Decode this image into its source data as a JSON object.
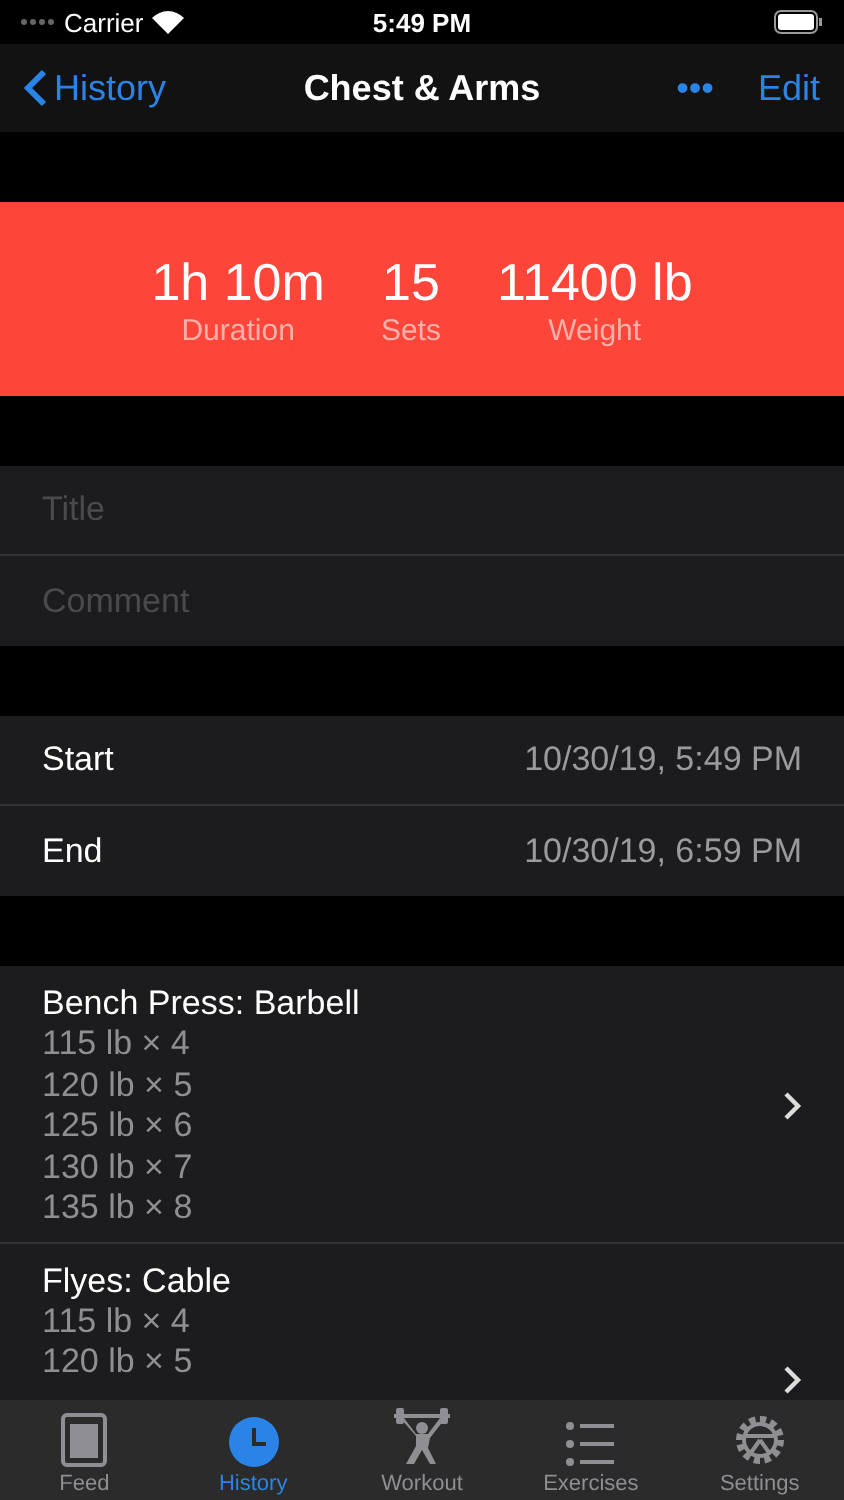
{
  "status_bar": {
    "carrier": "Carrier",
    "time": "5:49 PM"
  },
  "nav": {
    "back": "History",
    "title": "Chest & Arms",
    "more": "•••",
    "edit": "Edit"
  },
  "summary": [
    {
      "value": "1h 10m",
      "label": "Duration"
    },
    {
      "value": "15",
      "label": "Sets"
    },
    {
      "value": "11400 lb",
      "label": "Weight"
    }
  ],
  "fields": [
    {
      "placeholder": "Title"
    },
    {
      "placeholder": "Comment"
    }
  ],
  "times": [
    {
      "label": "Start",
      "value": "10/30/19, 5:49 PM"
    },
    {
      "label": "End",
      "value": "10/30/19, 6:59 PM"
    }
  ],
  "exercises": [
    {
      "name": "Bench Press: Barbell",
      "sets": [
        "115 lb × 4",
        "120 lb × 5",
        "125 lb × 6",
        "130 lb × 7",
        "135 lb × 8"
      ]
    },
    {
      "name": "Flyes: Cable",
      "sets": [
        "115 lb × 4",
        "120 lb × 5"
      ]
    }
  ],
  "tabs": [
    {
      "label": "Feed",
      "selected": false
    },
    {
      "label": "History",
      "selected": true
    },
    {
      "label": "Workout",
      "selected": false
    },
    {
      "label": "Exercises",
      "selected": false
    },
    {
      "label": "Settings",
      "selected": false
    }
  ]
}
